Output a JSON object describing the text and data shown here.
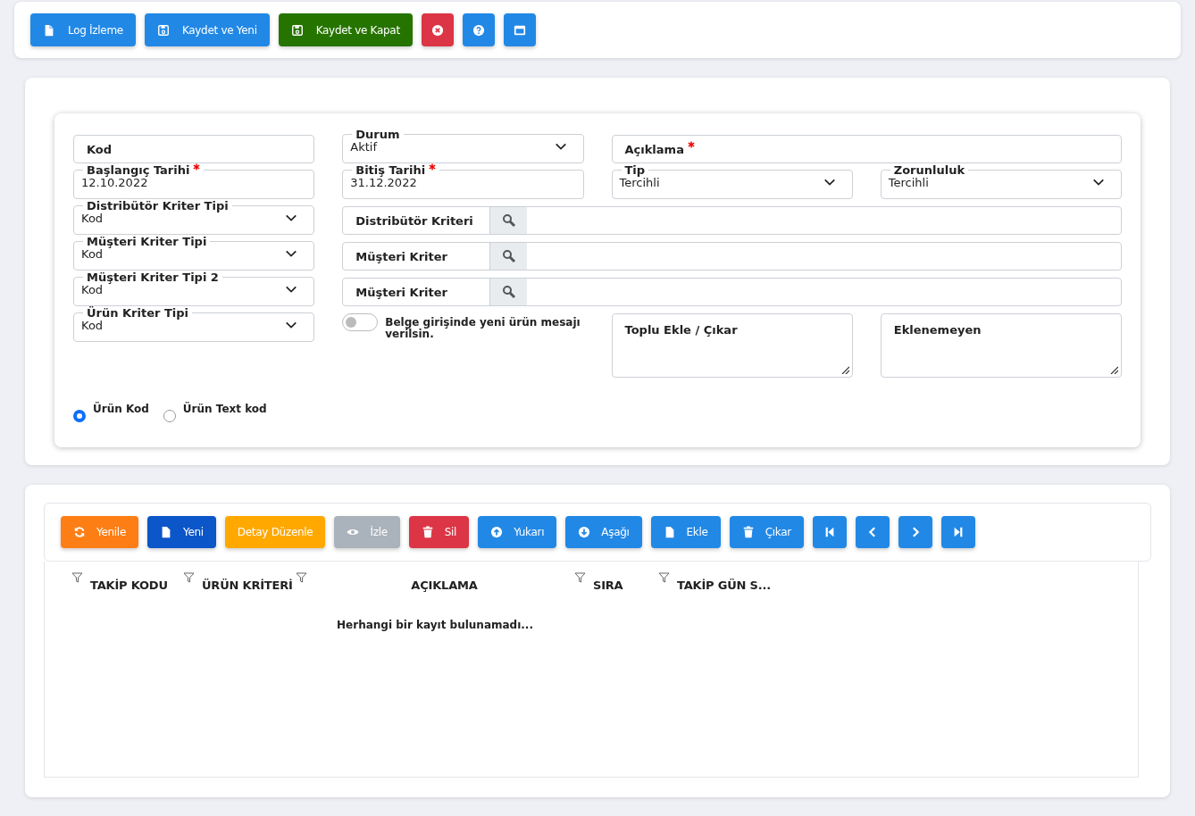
{
  "toolbar": [
    {
      "kind": "log",
      "label": "Log İzleme"
    },
    {
      "kind": "save-new",
      "label": "Kaydet ve Yeni"
    },
    {
      "kind": "save-close",
      "label": "Kaydet ve Kapat"
    },
    {
      "kind": "cancel"
    },
    {
      "kind": "help"
    },
    {
      "kind": "window"
    }
  ],
  "form": {
    "rows": [
      [
        {
          "kind": "text",
          "label": "Kod",
          "required": false
        },
        {
          "kind": "select",
          "label": "Durum",
          "value": "Aktif",
          "required": false
        },
        {
          "kind": "text",
          "label": "Açıklama",
          "required": true
        }
      ],
      [
        {
          "kind": "date",
          "label": "Başlangıç Tarihi",
          "value": "12.10.2022",
          "required": true
        },
        {
          "kind": "date",
          "label": "Bitiş Tarihi",
          "value": "31.12.2022",
          "required": true
        },
        {
          "kind": "select",
          "label": "Tip",
          "value": "Tercihli",
          "required": false
        },
        {
          "kind": "select",
          "label": "Zorunluluk",
          "value": "Tercihli",
          "required": false
        }
      ],
      [
        {
          "kind": "select",
          "label": "Distribütör Kriter Tipi",
          "value": "Kod",
          "required": false
        },
        {
          "kind": "lookup",
          "label": "Distribütör Kriteri",
          "required": false
        }
      ],
      [
        {
          "kind": "select",
          "label": "Müşteri Kriter Tipi",
          "value": "Kod",
          "required": false
        },
        {
          "kind": "lookup",
          "label": "Müşteri Kriter",
          "required": false
        }
      ],
      [
        {
          "kind": "select",
          "label": "Müşteri Kriter Tipi 2",
          "value": "Kod",
          "required": false
        },
        {
          "kind": "lookup",
          "label": "Müşteri Kriter",
          "required": false
        }
      ],
      [
        {
          "kind": "select",
          "label": "Ürün Kriter Tipi",
          "value": "Kod",
          "required": false
        },
        {
          "kind": "toggle",
          "label": "Belge girişinde yeni ürün mesajı verilsin.",
          "on": false
        },
        {
          "kind": "textarea",
          "label": "Toplu Ekle / Çıkar",
          "required": false
        },
        {
          "kind": "textarea",
          "label": "Eklenemeyen",
          "required": false
        }
      ]
    ],
    "radios": [
      {
        "label": "Ürün Kod",
        "selected": true
      },
      {
        "label": "Ürün Text kod",
        "selected": false
      }
    ]
  },
  "grid_toolbar": [
    {
      "kind": "refresh",
      "label": "Yenile",
      "disabled": false
    },
    {
      "kind": "new",
      "label": "Yeni",
      "disabled": false
    },
    {
      "kind": "edit",
      "label": "Detay Düzenle",
      "disabled": false
    },
    {
      "kind": "view",
      "label": "İzle",
      "disabled": true
    },
    {
      "kind": "delete",
      "label": "Sil",
      "disabled": false
    },
    {
      "kind": "up",
      "label": "Yukarı",
      "disabled": false
    },
    {
      "kind": "down",
      "label": "Aşağı",
      "disabled": false
    },
    {
      "kind": "add",
      "label": "Ekle",
      "disabled": false
    },
    {
      "kind": "remove",
      "label": "Çıkar",
      "disabled": false
    },
    {
      "kind": "first",
      "disabled": false
    },
    {
      "kind": "prev",
      "disabled": false
    },
    {
      "kind": "next",
      "disabled": false
    },
    {
      "kind": "last",
      "disabled": false
    }
  ],
  "table": {
    "columns": [
      "TAKİP KODU",
      "ÜRÜN KRİTERİ",
      "AÇIKLAMA",
      "SIRA",
      "TAKİP GÜN S..."
    ],
    "empty_message": "Herhangi bir kayıt bulunamadı..."
  }
}
